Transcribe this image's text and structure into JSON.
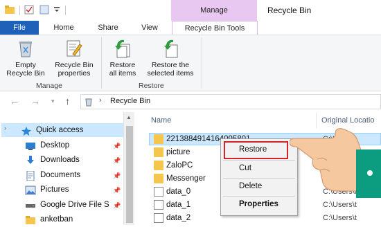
{
  "titlebar": {
    "manage_label": "Manage",
    "window_title": "Recycle Bin"
  },
  "tabs": [
    "File",
    "Home",
    "Share",
    "View",
    "Recycle Bin Tools"
  ],
  "ribbon": {
    "buttons": [
      {
        "label": "Empty\nRecycle Bin",
        "icon": "empty-recycle-bin-icon"
      },
      {
        "label": "Recycle Bin\nproperties",
        "icon": "properties-icon"
      },
      {
        "label": "Restore\nall items",
        "icon": "restore-all-icon"
      },
      {
        "label": "Restore the\nselected items",
        "icon": "restore-selected-icon"
      }
    ],
    "groups": [
      "Manage",
      "Restore"
    ]
  },
  "address": {
    "path": "Recycle Bin"
  },
  "columns": {
    "name": "Name",
    "original_location": "Original Locatio"
  },
  "nav": {
    "items": [
      {
        "label": "Quick access",
        "icon": "star-icon"
      },
      {
        "label": "Desktop",
        "icon": "desktop-icon"
      },
      {
        "label": "Downloads",
        "icon": "download-icon"
      },
      {
        "label": "Documents",
        "icon": "documents-icon"
      },
      {
        "label": "Pictures",
        "icon": "pictures-icon"
      },
      {
        "label": "Google Drive File S",
        "icon": "drive-icon"
      },
      {
        "label": "anketban",
        "icon": "folder-icon"
      }
    ]
  },
  "files": [
    {
      "name": "2213884914164095801",
      "type": "folder",
      "orig": "C:\\Users\\t"
    },
    {
      "name": "picture",
      "type": "folder",
      "orig": ""
    },
    {
      "name": "ZaloPC",
      "type": "folder",
      "orig": ""
    },
    {
      "name": "Messenger",
      "type": "folder",
      "orig": ""
    },
    {
      "name": "data_0",
      "type": "file",
      "orig": "C:\\Users\\t"
    },
    {
      "name": "data_1",
      "type": "file",
      "orig": "C:\\Users\\t"
    },
    {
      "name": "data_2",
      "type": "file",
      "orig": "C:\\Users\\t"
    }
  ],
  "context_menu": {
    "items": [
      "Restore",
      "Cut",
      "Delete",
      "Properties"
    ]
  },
  "colors": {
    "file_tab": "#1f61b8",
    "context_tab": "#e8c8f0",
    "selection": "#cce8ff",
    "highlight_box": "#d2232a",
    "folder": "#f6c54b"
  }
}
